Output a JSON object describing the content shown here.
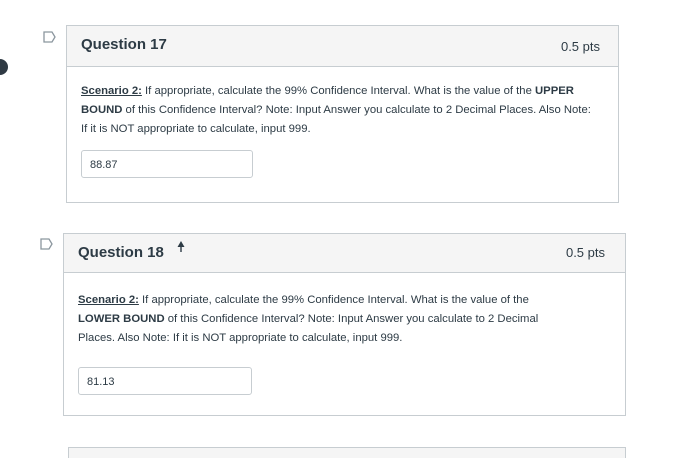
{
  "questions": [
    {
      "title": "Question 17",
      "points": "0.5 pts",
      "scenario_label": "Scenario 2:",
      "text_part1": " If appropriate, calculate the 99% Confidence Interval. What is the value of the ",
      "emphasis": "UPPER BOUND",
      "text_part2": " of this Confidence Interval? Note: Input Answer you calculate to 2 Decimal Places. Also Note: If it is NOT appropriate to calculate, input 999.",
      "answer": "88.87",
      "flag_icon": "flag-icon"
    },
    {
      "title": "Question 18",
      "points": "0.5 pts",
      "scenario_label": "Scenario 2:",
      "text_part1": " If appropriate, calculate the 99% Confidence Interval. What is the value of the ",
      "emphasis": "LOWER BOUND",
      "text_part2": " of this Confidence Interval? Note: Input Answer you calculate to 2 Decimal Places. Also Note: If it is NOT appropriate to calculate, input 999.",
      "answer": "81.13",
      "flag_icon": "flag-icon"
    }
  ]
}
